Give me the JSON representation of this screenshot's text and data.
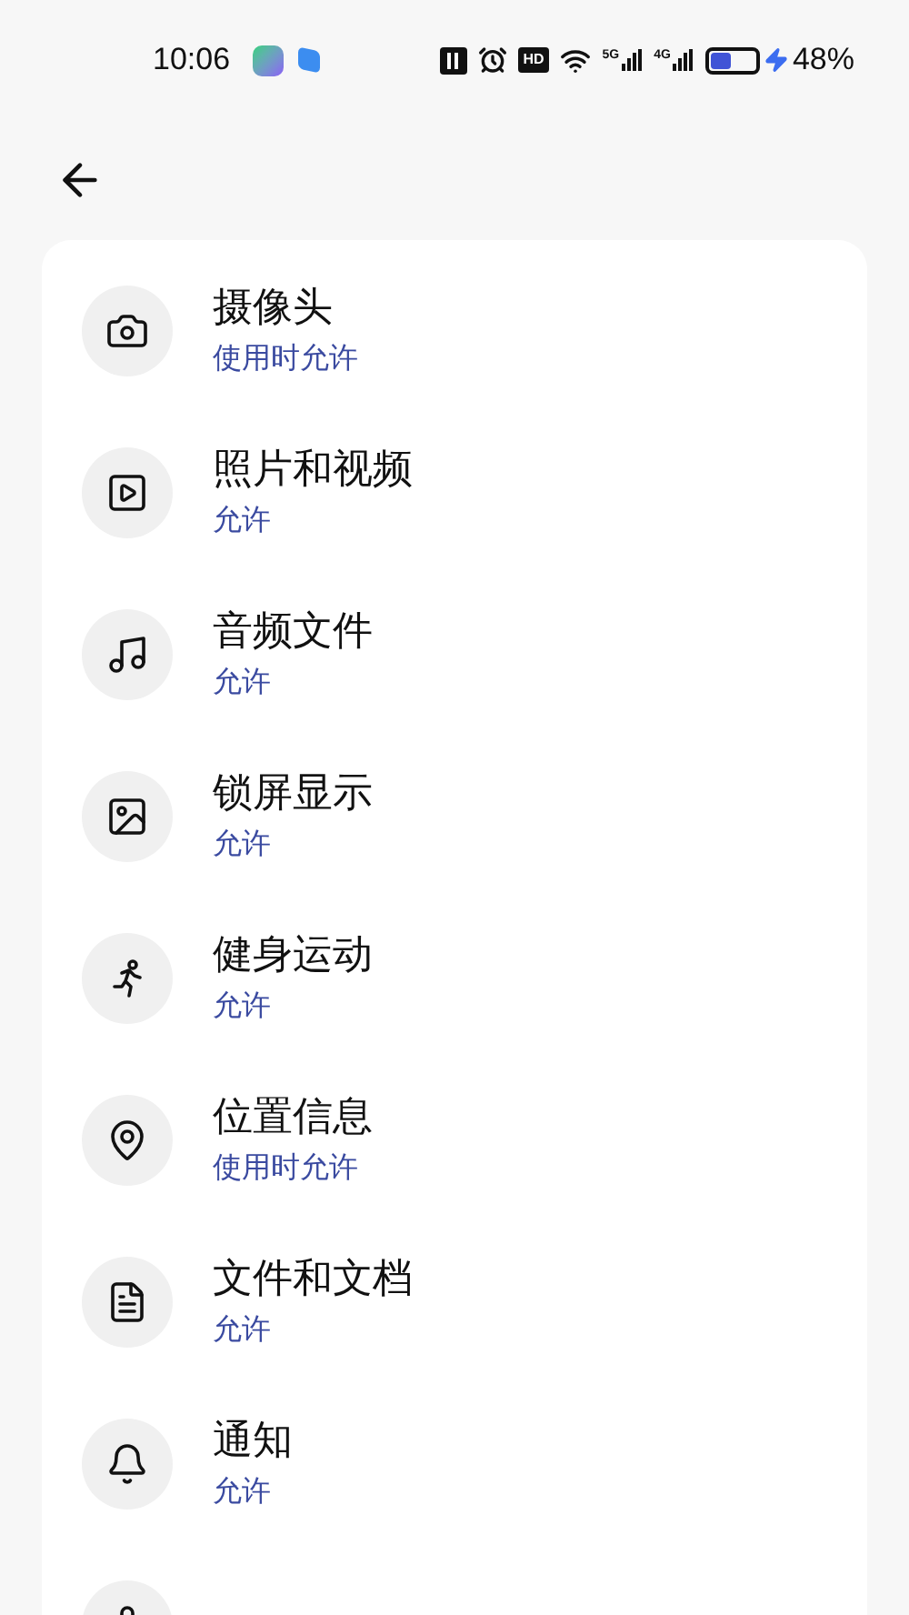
{
  "status_bar": {
    "time": "10:06",
    "hd": "HD",
    "networks": [
      "5G",
      "4G"
    ],
    "battery": "48%"
  },
  "permissions": [
    {
      "kind": "entry",
      "name": "摄像头",
      "status": "使用时允许"
    },
    {
      "kind": "entry",
      "name": "照片和视频",
      "status": "允许"
    },
    {
      "kind": "entry",
      "name": "音频文件",
      "status": "允许"
    },
    {
      "kind": "entry",
      "name": "锁屏显示",
      "status": "允许"
    },
    {
      "kind": "entry",
      "name": "健身运动",
      "status": "允许"
    },
    {
      "kind": "entry",
      "name": "位置信息",
      "status": "使用时允许"
    },
    {
      "kind": "entry",
      "name": "文件和文档",
      "status": "允许"
    },
    {
      "kind": "entry",
      "name": "通知",
      "status": "允许"
    },
    {
      "kind": "cut_off"
    }
  ]
}
